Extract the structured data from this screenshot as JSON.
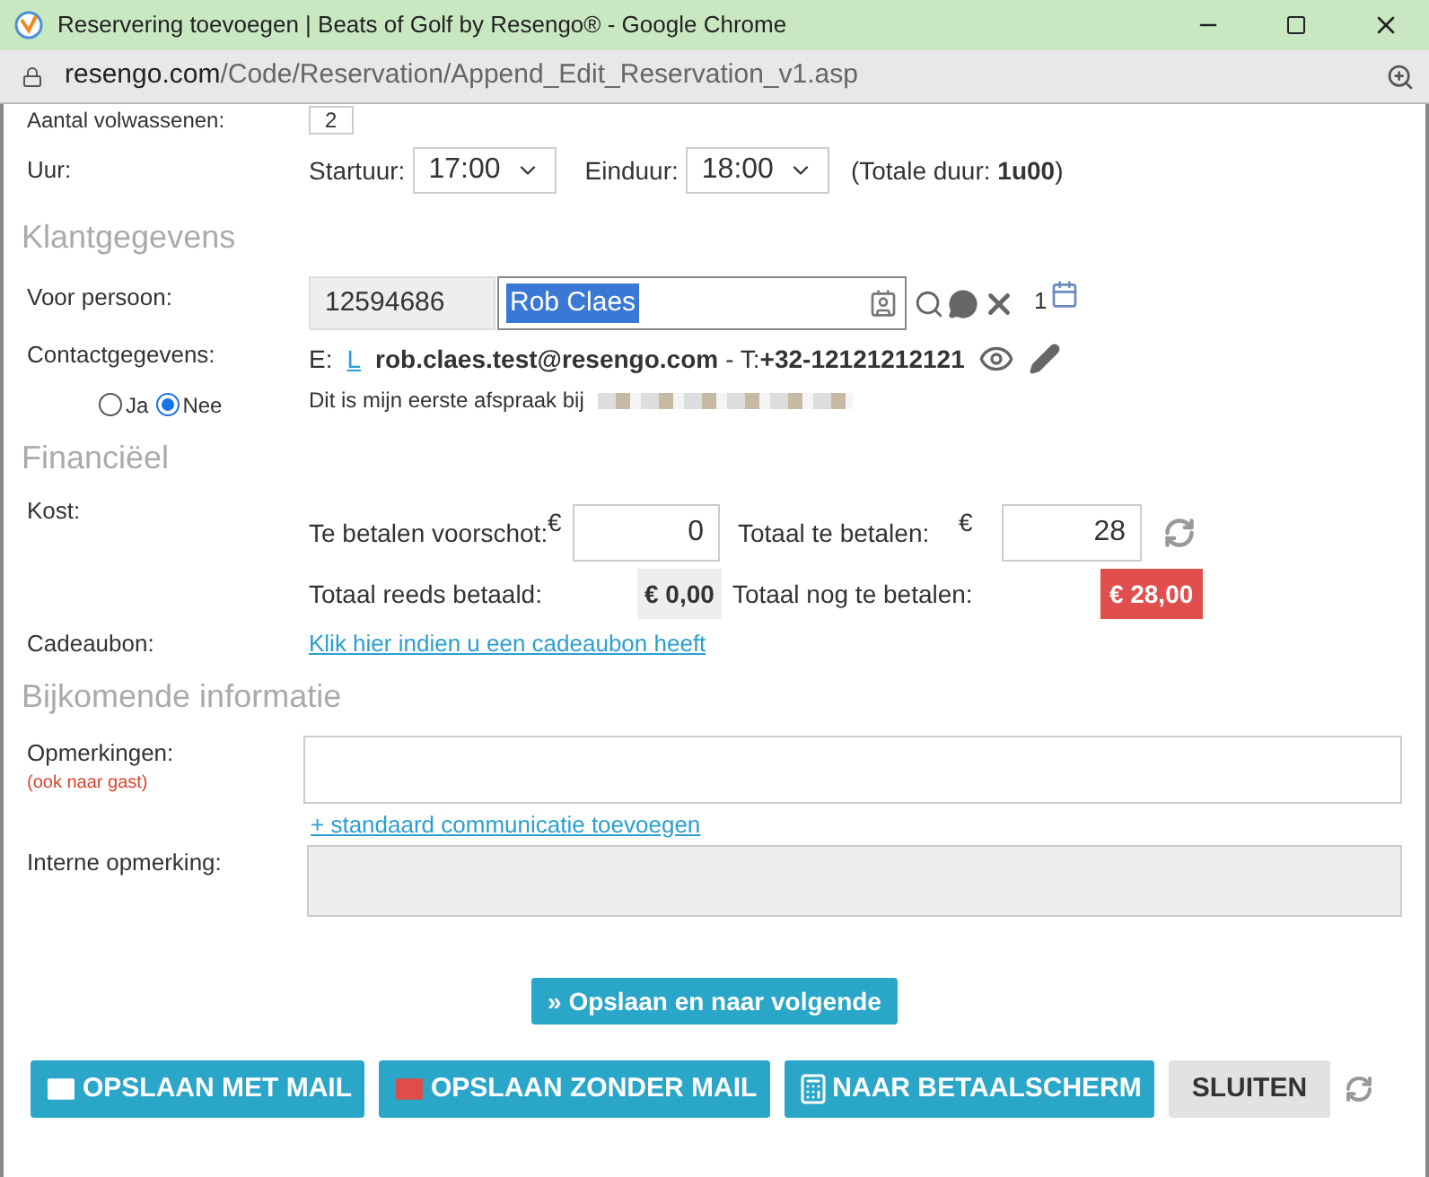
{
  "window": {
    "title": "Reservering toevoegen | Beats of Golf by Resengo® - Google Chrome",
    "url_host": "resengo.com",
    "url_path": "/Code/Reservation/Append_Edit_Reservation_v1.asp"
  },
  "adults": {
    "label": "Aantal volwassenen:",
    "value": "2"
  },
  "hour": {
    "label": "Uur:",
    "start_label": "Startuur:",
    "start": "17:00",
    "end_label": "Einduur:",
    "end": "18:00",
    "duration_prefix": "(Totale duur: ",
    "duration": "1u00",
    "duration_suffix": ")"
  },
  "sections": [
    "Klantgegevens",
    "Financiëel",
    "Bijkomende informatie"
  ],
  "customer": {
    "label": "Voor persoon:",
    "id": "12594686",
    "name": "Rob Claes",
    "count": "1",
    "contact_label": "Contactgegevens:",
    "email_prefix": "E:",
    "email_link": "L",
    "email": "rob.claes.test@resengo.com",
    "phone_prefix": "- T:",
    "phone": "+32-12121212121",
    "first_visit_text": "Dit is mijn eerste afspraak bij",
    "radios": [
      {
        "label": "Ja",
        "selected": false
      },
      {
        "label": "Nee",
        "selected": true
      }
    ]
  },
  "finance": {
    "label": "Kost:",
    "deposit_label": "Te betalen voorschot:",
    "currency": "€",
    "deposit": "0",
    "total_label": "Totaal te betalen:",
    "total": "28",
    "paid_label": "Totaal reeds betaald:",
    "paid": "€ 0,00",
    "due_label": "Totaal nog te betalen:",
    "due": "€ 28,00",
    "voucher_label": "Cadeaubon:",
    "voucher_link": "Klik hier indien u een cadeaubon heeft"
  },
  "info": {
    "remarks_label": "Opmerkingen:",
    "remarks_note": "(ook naar gast)",
    "add_link": "+ standaard communicatie toevoegen",
    "internal_label": "Interne opmerking:"
  },
  "next_button": "» Opslaan en naar volgende",
  "buttons": [
    {
      "label": "OPSLAAN MET MAIL",
      "kind": "mail"
    },
    {
      "label": "OPSLAAN ZONDER MAIL",
      "kind": "nomail"
    },
    {
      "label": "NAAR BETAALSCHERM",
      "kind": "register"
    },
    {
      "label": "SLUITEN",
      "kind": "plain"
    }
  ]
}
